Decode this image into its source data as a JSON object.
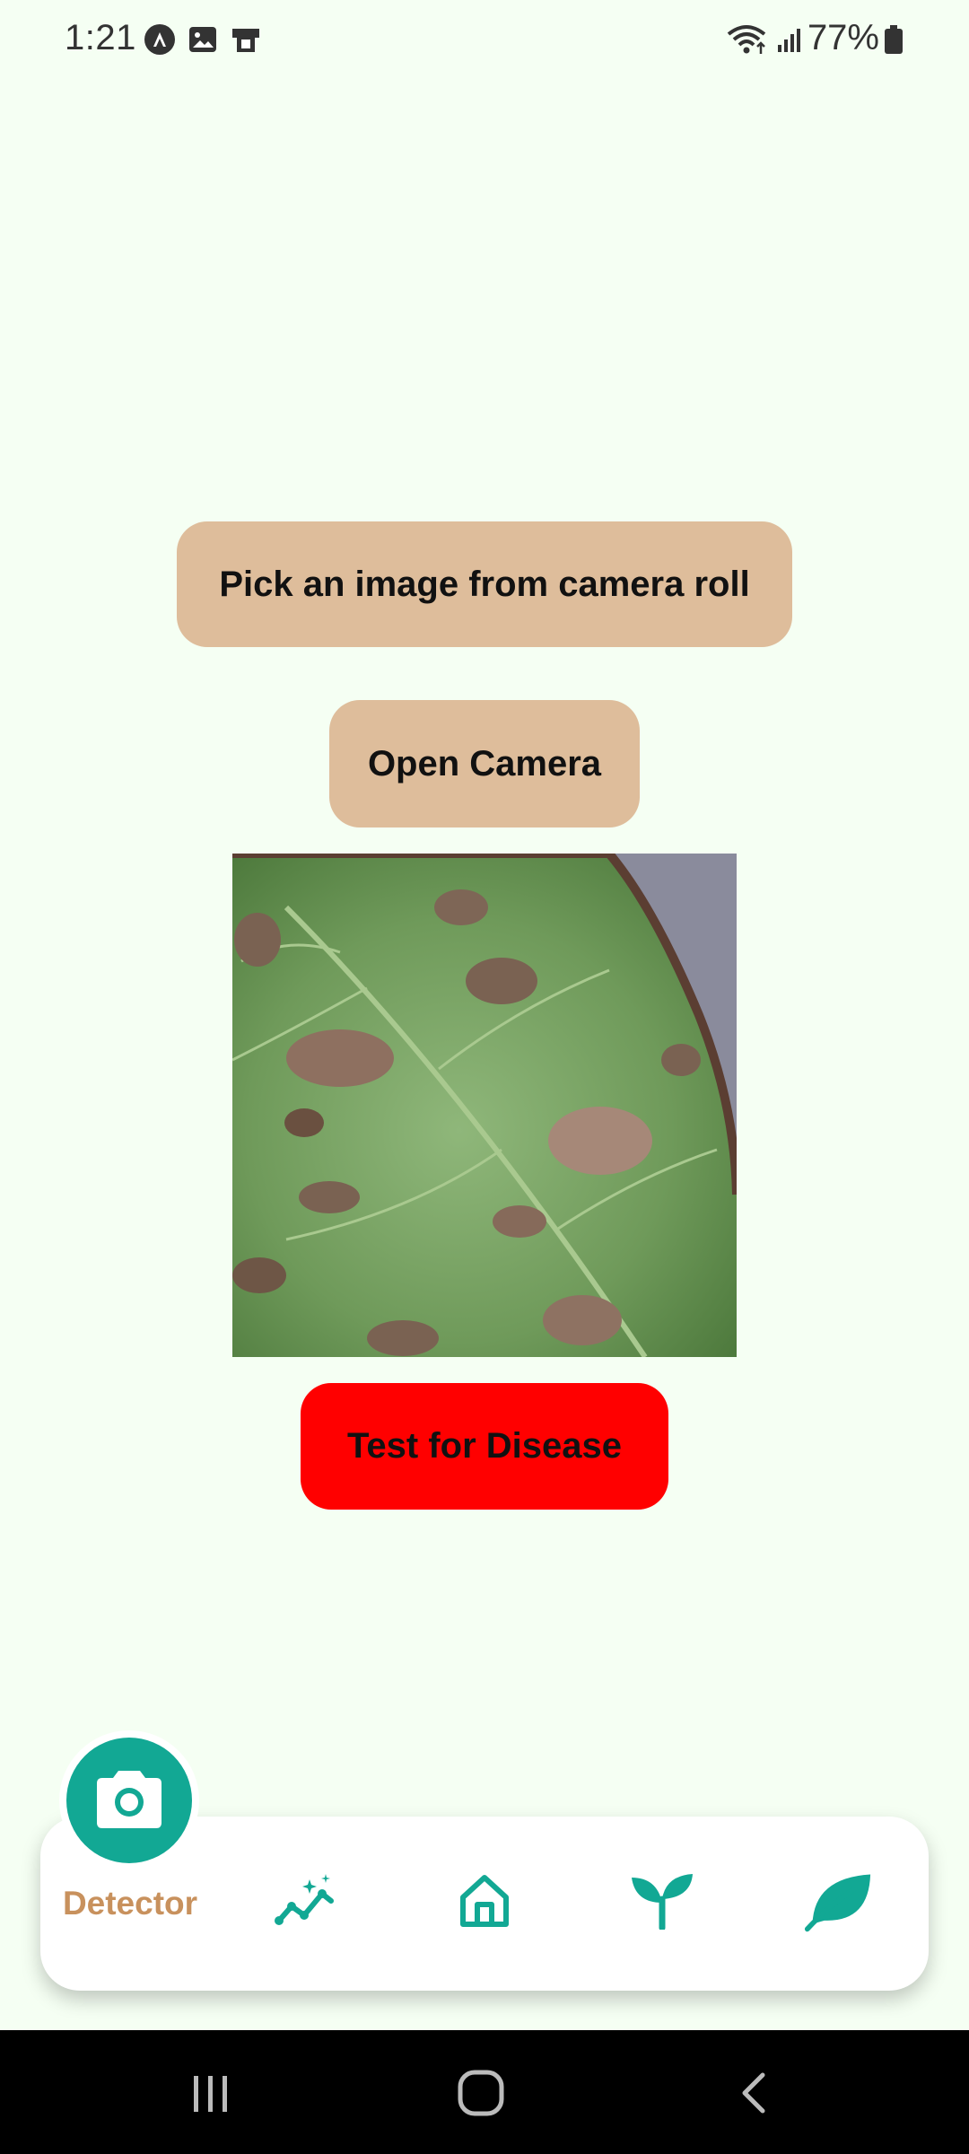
{
  "status_bar": {
    "time": "1:21",
    "battery": "77%",
    "icons": [
      "android-auto-icon",
      "image-icon",
      "desk-icon",
      "wifi-icon",
      "signal-icon",
      "battery-icon"
    ]
  },
  "actions": {
    "pick_image_label": "Pick an image from camera roll",
    "open_camera_label": "Open Camera",
    "test_label": "Test for Disease"
  },
  "bottom_nav": {
    "active_label": "Detector",
    "items": [
      "camera-icon",
      "analytics-icon",
      "home-icon",
      "sprout-icon",
      "leaf-icon"
    ]
  },
  "colors": {
    "background": "#f5fff3",
    "button_tan": "#debd9b",
    "button_red": "#ff0000",
    "accent_teal": "#12a894",
    "label_tan": "#c8915d"
  }
}
